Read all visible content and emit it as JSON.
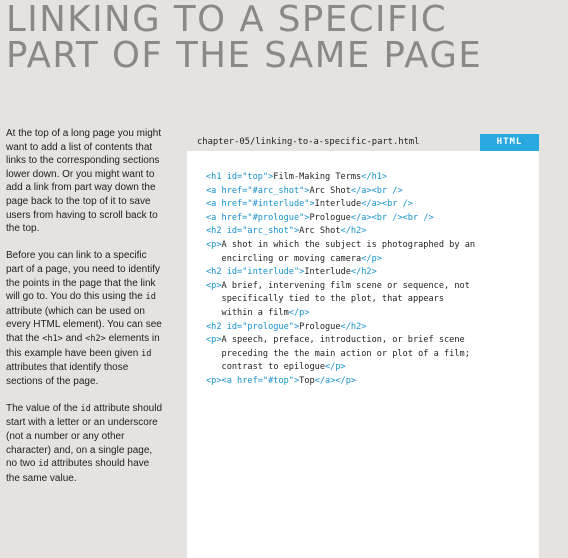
{
  "page": {
    "title_lines": [
      "LINKING TO A SPECIFIC",
      "PART OF THE SAME PAGE"
    ]
  },
  "body": {
    "p1": "At the top of a long page you might want to add a list of contents that links to the corresponding sections lower down. Or you might want to add a link from part way down the page back to the top of it to save users from having to scroll back to the top.",
    "p2_a": "Before you can link to a specific part of a page, you need to identify the points in the page that the link will go to. You do this using the ",
    "p2_code1": "id",
    "p2_b": " attribute (which can be used on every HTML element). You can see that the ",
    "p2_code2": "<h1>",
    "p2_c": " and ",
    "p2_code3": "<h2>",
    "p2_d": " elements in this example have been given ",
    "p2_code4": "id",
    "p2_e": " attributes that identify those sections of the page.",
    "p3_a": "The value of the ",
    "p3_code1": "id",
    "p3_b": " attribute should start with a letter or an underscore (not a number or any other character) and, on a single page, no two ",
    "p3_code2": "id",
    "p3_c": " attributes should have the same value."
  },
  "code_panel": {
    "filename": "chapter-05/linking-to-a-specific-part.html",
    "language": "HTML",
    "lines": [
      [
        [
          "tag",
          "<h1 id=\"top\">"
        ],
        [
          "text",
          "Film-Making Terms"
        ],
        [
          "tag",
          "</h1>"
        ]
      ],
      [
        [
          "tag",
          "<a href=\"#arc_shot\">"
        ],
        [
          "text",
          "Arc Shot"
        ],
        [
          "tag",
          "</a><br />"
        ]
      ],
      [
        [
          "tag",
          "<a href=\"#interlude\">"
        ],
        [
          "text",
          "Interlude"
        ],
        [
          "tag",
          "</a><br />"
        ]
      ],
      [
        [
          "tag",
          "<a href=\"#prologue\">"
        ],
        [
          "text",
          "Prologue"
        ],
        [
          "tag",
          "</a><br /><br />"
        ]
      ],
      [
        [
          "tag",
          "<h2 id=\"arc_shot\">"
        ],
        [
          "text",
          "Arc Shot"
        ],
        [
          "tag",
          "</h2>"
        ]
      ],
      [
        [
          "tag",
          "<p>"
        ],
        [
          "text",
          "A shot in which the subject is photographed by an"
        ]
      ],
      [
        [
          "text",
          "   encircling or moving camera"
        ],
        [
          "tag",
          "</p>"
        ]
      ],
      [
        [
          "tag",
          "<h2 id=\"interlude\">"
        ],
        [
          "text",
          "Interlude"
        ],
        [
          "tag",
          "</h2>"
        ]
      ],
      [
        [
          "tag",
          "<p>"
        ],
        [
          "text",
          "A brief, intervening film scene or sequence, not"
        ]
      ],
      [
        [
          "text",
          "   specifically tied to the plot, that appears"
        ]
      ],
      [
        [
          "text",
          "   within a film"
        ],
        [
          "tag",
          "</p>"
        ]
      ],
      [
        [
          "tag",
          "<h2 id=\"prologue\">"
        ],
        [
          "text",
          "Prologue"
        ],
        [
          "tag",
          "</h2>"
        ]
      ],
      [
        [
          "tag",
          "<p>"
        ],
        [
          "text",
          "A speech, preface, introduction, or brief scene"
        ]
      ],
      [
        [
          "text",
          "   preceding the the main action or plot of a film;"
        ]
      ],
      [
        [
          "text",
          "   contrast to epilogue"
        ],
        [
          "tag",
          "</p>"
        ]
      ],
      [
        [
          "tag",
          "<p><a href=\"#top\">"
        ],
        [
          "text",
          "Top"
        ],
        [
          "tag",
          "</a></p>"
        ]
      ]
    ]
  },
  "colors": {
    "background": "#e6e2df",
    "title": "#8b8886",
    "text": "#1f1f1f",
    "code_tag": "#1592cc",
    "badge": "#29a9e0",
    "panel": "#ffffff"
  }
}
